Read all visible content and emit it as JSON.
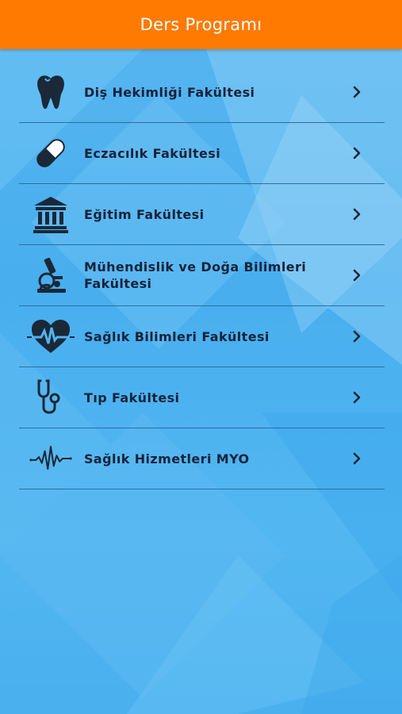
{
  "app_bar": {
    "title": "Ders Programı"
  },
  "colors": {
    "app_bar": "#ff7a00",
    "background": "#4fb4f0",
    "text": "#16233a",
    "divider": "#2d6ea3"
  },
  "faculties": [
    {
      "label": "Diş Hekimliği Fakültesi",
      "icon": "tooth-icon"
    },
    {
      "label": "Eczacılık Fakültesi",
      "icon": "pill-icon"
    },
    {
      "label": "Eğitim Fakültesi",
      "icon": "building-icon"
    },
    {
      "label": "Mühendislik ve Doğa Bilimleri Fakültesi",
      "icon": "microscope-icon"
    },
    {
      "label": "Sağlık Bilimleri Fakültesi",
      "icon": "heart-pulse-icon"
    },
    {
      "label": "Tıp Fakültesi",
      "icon": "stethoscope-icon"
    },
    {
      "label": "Sağlık Hizmetleri MYO",
      "icon": "heartbeat-line-icon"
    }
  ]
}
